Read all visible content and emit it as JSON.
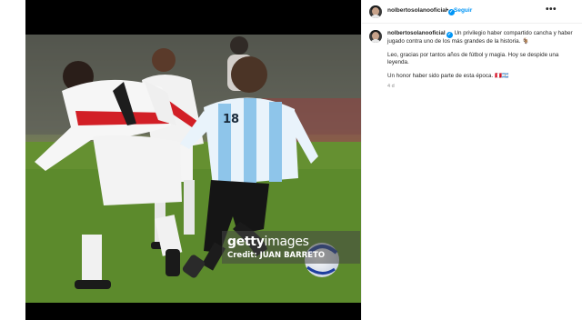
{
  "post": {
    "username": "nolbertosolanooficial",
    "follow_label": "Seguir",
    "more_label": "•••",
    "separator": "•",
    "verified_mark": "✓",
    "caption": {
      "line1": "Un privilegio haber compartido cancha y haber jugado contra uno de los más grandes de la historia. 🐐",
      "line2": "Leo, gracias por tantos años de fútbol y magia. Hoy se despide una leyenda.",
      "line3": "Un honor haber sido parte de esta época. 🇵🇪🇦🇷"
    },
    "time": "4 d"
  },
  "image": {
    "watermark_brand": "getty",
    "watermark_brand2": "images",
    "watermark_credit": "Credit: JUAN BARRETO",
    "jersey_number": "18"
  },
  "colors": {
    "accent": "#0095f6",
    "argentina_blue": "#8ec5ea",
    "peru_red": "#d21f26",
    "pitch": "#5f8a30"
  }
}
